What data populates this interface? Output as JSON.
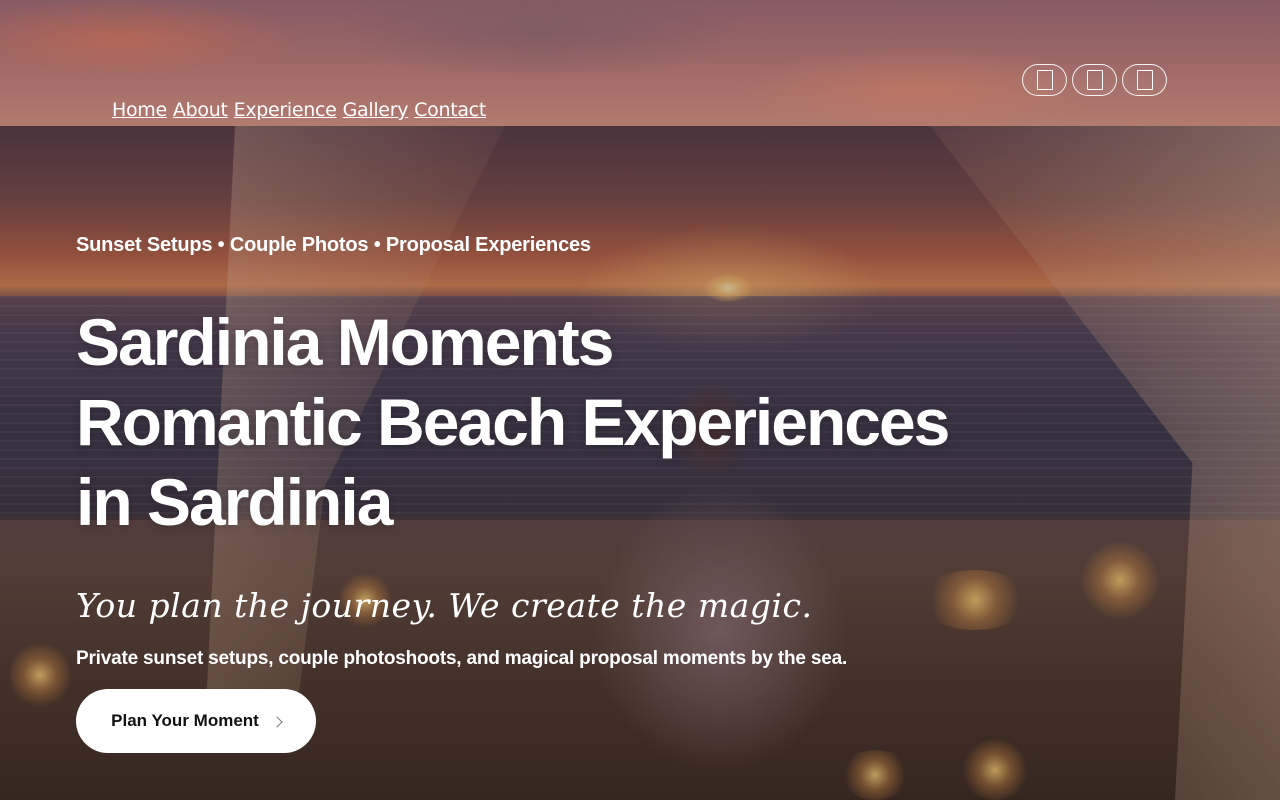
{
  "header": {
    "nav": [
      {
        "label": "Home"
      },
      {
        "label": "About"
      },
      {
        "label": "Experience"
      },
      {
        "label": "Gallery"
      },
      {
        "label": "Contact"
      }
    ],
    "social": [
      {
        "icon": "social-icon-1"
      },
      {
        "icon": "social-icon-2"
      },
      {
        "icon": "social-icon-3"
      }
    ]
  },
  "hero": {
    "tagline": "Sunset Setups • Couple Photos • Proposal Experiences",
    "title_lines": [
      "Sardinia Moments",
      "Romantic Beach Experiences",
      "in Sardinia"
    ],
    "script": "You plan the journey. We create the magic.",
    "subline": "Private sunset setups, couple photoshoots, and magical proposal moments by the sea.",
    "cta_label": "Plan Your Moment",
    "cta_icon": "chevron-right-icon"
  },
  "colors": {
    "text": "#ffffff",
    "cta_background": "#ffffff",
    "cta_text": "#111111"
  }
}
